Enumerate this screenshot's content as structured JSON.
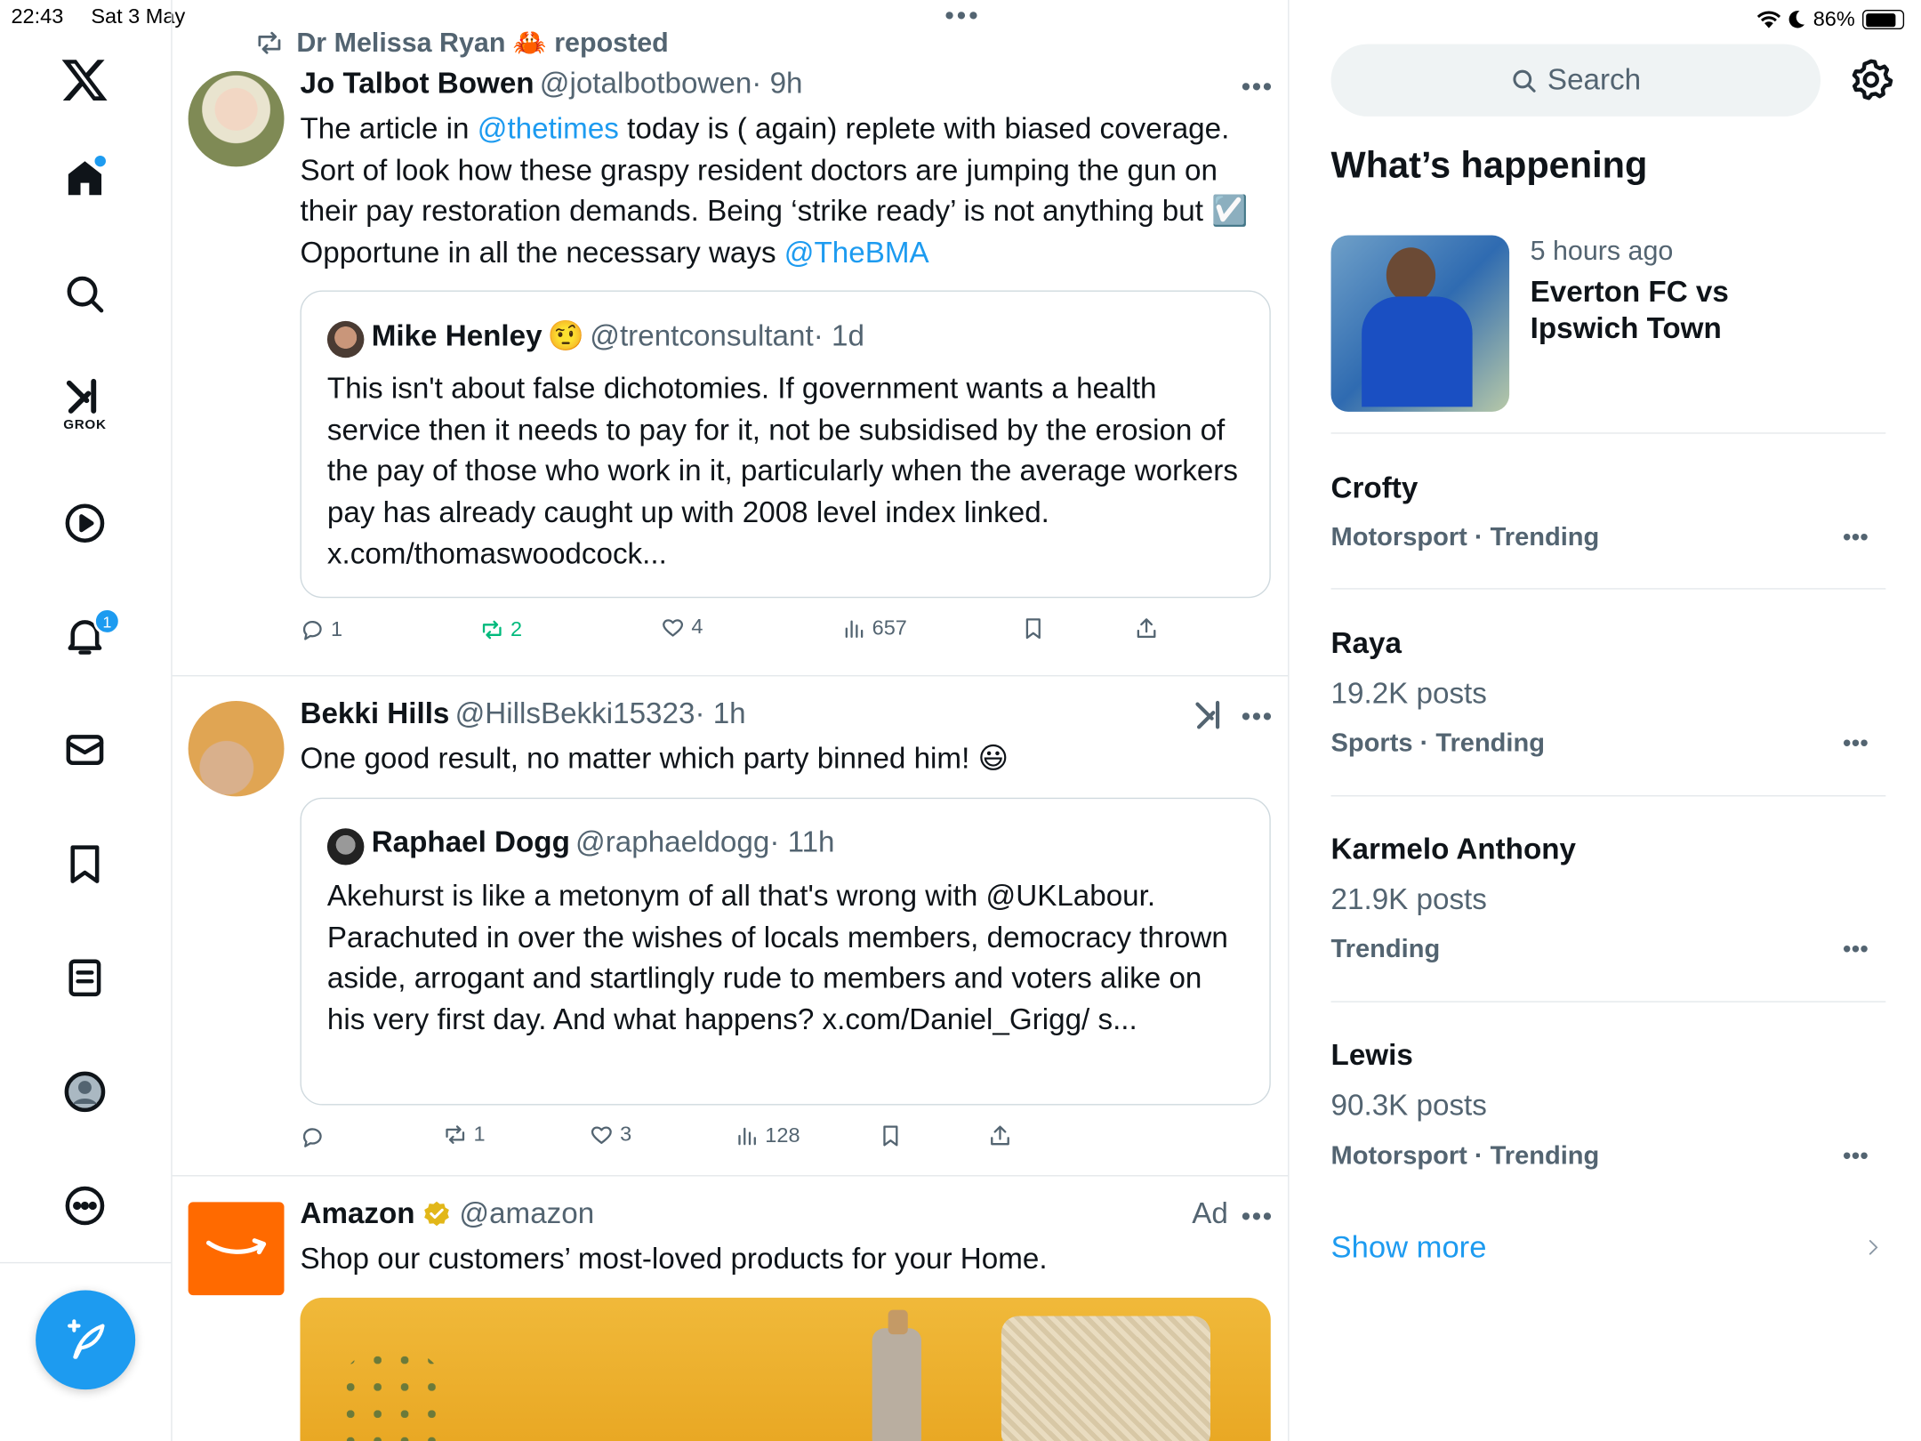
{
  "status_bar": {
    "time": "22:43",
    "date": "Sat 3 May",
    "battery": "86%"
  },
  "nav": {
    "grok_label": "GROK",
    "notification_count": "1",
    "items": [
      "x-logo-icon",
      "home-icon",
      "search-icon",
      "grok-icon",
      "video-icon",
      "notifications-icon",
      "messages-icon",
      "bookmarks-icon",
      "lists-icon",
      "profile-icon",
      "more-icon",
      "compose-icon"
    ]
  },
  "tweets": [
    {
      "repost_by": "Dr Melissa Ryan 🦀 reposted",
      "name": "Jo Talbot Bowen",
      "handle": "@jotalbotbowen",
      "time": "· 9h",
      "body_parts": [
        "The article in ",
        "@thetimes",
        " today is ( again) replete with biased coverage. Sort of look how these graspy resident doctors are jumping the gun on their pay restoration demands. Being ‘strike ready’ is not anything but ",
        "☑️",
        " Opportune in all the necessary ways ",
        "@TheBMA"
      ],
      "quote": {
        "name": "Mike Henley",
        "emoji": "🤨",
        "handle": "@trentconsultant",
        "time": "· 1d",
        "body": "This isn't about false dichotomies. If government wants a health service then it needs to pay for it, not be subsidised by the erosion of the pay of those who work in it, particularly when the average workers pay has already caught up with 2008 level index linked. x.com/thomaswoodcock..."
      },
      "actions": {
        "replies": "1",
        "reposts": "2",
        "likes": "4",
        "views": "657"
      }
    },
    {
      "name": "Bekki Hills",
      "handle": "@HillsBekki15323",
      "time": "· 1h",
      "body": "One good result, no matter which party binned him! 😃",
      "quote": {
        "name": "Raphael Dogg",
        "handle": "@raphaeldogg",
        "time": "· 11h",
        "body": "Akehurst is like a metonym of all that's wrong with @UKLabour. Parachuted in over the wishes of locals members, democracy thrown aside, arrogant and startlingly rude to members and voters alike on his very first day. And what happens? x.com/Daniel_Grigg/ s..."
      },
      "actions": {
        "replies": "",
        "reposts": "1",
        "likes": "3",
        "views": "128"
      }
    },
    {
      "name": "Amazon",
      "handle": "@amazon",
      "ad_label": "Ad",
      "body": "Shop our customers’ most-loved products for your Home."
    }
  ],
  "sidebar": {
    "search_placeholder": "Search",
    "heading": "What’s happening",
    "featured": {
      "time": "5 hours ago",
      "title": "Everton FC vs Ipswich Town"
    },
    "trends": [
      {
        "title": "Crofty",
        "posts": "",
        "category": "Motorsport · Trending"
      },
      {
        "title": "Raya",
        "posts": "19.2K posts",
        "category": "Sports · Trending"
      },
      {
        "title": "Karmelo Anthony",
        "posts": "21.9K posts",
        "category": "Trending"
      },
      {
        "title": "Lewis",
        "posts": "90.3K posts",
        "category": "Motorsport · Trending"
      }
    ],
    "show_more": "Show more"
  },
  "colors": {
    "accent": "#1d9bf0",
    "repost_green": "#00ba7c",
    "muted": "#536471",
    "amazon_orange": "#ff6a00"
  }
}
